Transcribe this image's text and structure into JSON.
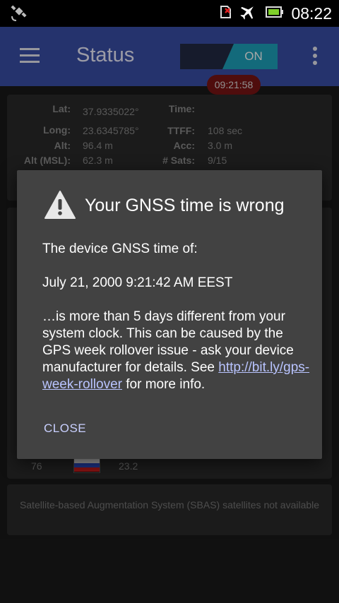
{
  "status_bar": {
    "time": "08:22",
    "icons": [
      "gps-satellite-icon",
      "sim-error-icon",
      "airplane-mode-icon",
      "battery-icon"
    ]
  },
  "toolbar": {
    "title": "Status",
    "toggle_label": "ON",
    "menu_icon": "hamburger-menu-icon",
    "overflow_icon": "overflow-menu-icon",
    "accent": "#3a4fa8",
    "toggle_color": "#1ea3bd"
  },
  "location": {
    "lat_label": "Lat:",
    "lat": "37.9335022°",
    "long_label": "Long:",
    "long": "23.6345785°",
    "alt_label": "Alt:",
    "alt": "96.4 m",
    "alt_msl_label": "Alt (MSL):",
    "alt_msl": "62.3 m",
    "time_label": "Time:",
    "time": "09:21:58",
    "ttff_label": "TTFF:",
    "ttff": "108 sec",
    "acc_label": "Acc:",
    "acc": "3.0 m",
    "sats_label": "# Sats:",
    "sats": "9/15"
  },
  "satellite_row": {
    "id": "76",
    "cn0": "23.2",
    "flag_icon": "russia-flag-icon"
  },
  "sbas": {
    "message": "Satellite-based Augmentation System (SBAS) satellites not available"
  },
  "dialog": {
    "icon": "warning-icon",
    "title": "Your GNSS time is wrong",
    "line1": "The device GNSS time of:",
    "datetime": "July 21, 2000 9:21:42 AM EEST",
    "body_pre": "…is more than 5 days different from your system clock. This can be caused by the GPS week rollover issue - ask your device manufacturer for details. See ",
    "link": "http://bit.ly/gps-week-rollover",
    "body_post": " for more info.",
    "close_label": "CLOSE"
  }
}
